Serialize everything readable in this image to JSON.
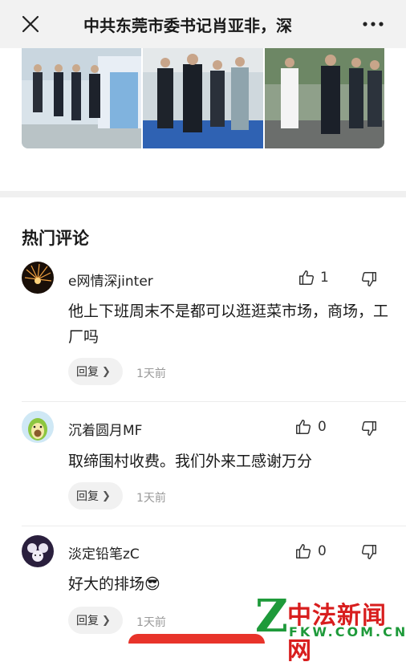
{
  "header": {
    "title": "中共东莞市委书记肖亚非，深",
    "close_icon": "close-icon",
    "more_icon": "more-horizontal-icon"
  },
  "photos": [
    "photo-1",
    "photo-2",
    "photo-3"
  ],
  "comments_section": {
    "title": "热门评论"
  },
  "comments": [
    {
      "username": "e网情深jinter",
      "likes": "1",
      "text": "他上下班周末不是都可以逛逛菜市场，商场，工厂吗",
      "reply_label": "回复",
      "time": "1天前"
    },
    {
      "username": "沉着圆月MF",
      "likes": "0",
      "text": "取缔围村收费。我们外来工感谢万分",
      "reply_label": "回复",
      "time": "1天前"
    },
    {
      "username": "淡定铅笔zC",
      "likes": "0",
      "text": "好大的排场😎",
      "reply_label": "回复",
      "time": "1天前"
    }
  ],
  "watermark": {
    "letter": "Z",
    "name": "中法新闻网",
    "url": "FKW.COM.CN"
  },
  "colors": {
    "accent_red": "#e8332a",
    "watermark_green": "#1e9a3a"
  }
}
